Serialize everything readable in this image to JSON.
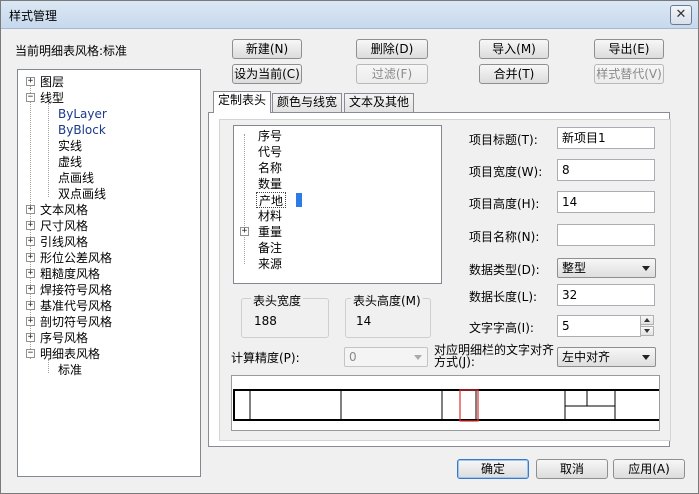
{
  "window": {
    "title": "样式管理",
    "close_glyph": "✕"
  },
  "current_style_label": "当前明细表风格:标准",
  "actions": {
    "new": "新建(N)",
    "delete": "删除(D)",
    "import": "导入(M)",
    "export": "导出(E)",
    "set_current": "设为当前(C)",
    "filter": "过滤(F)",
    "merge": "合并(T)",
    "replace_style": "样式替代(V)"
  },
  "tree": {
    "items": [
      {
        "label": "图层",
        "expander": "+"
      },
      {
        "label": "线型",
        "expander": "−"
      },
      {
        "label": "ByLayer"
      },
      {
        "label": "ByBlock"
      },
      {
        "label": "实线"
      },
      {
        "label": "虚线"
      },
      {
        "label": "点画线"
      },
      {
        "label": "双点画线"
      },
      {
        "label": "文本风格",
        "expander": "+"
      },
      {
        "label": "尺寸风格",
        "expander": "+"
      },
      {
        "label": "引线风格",
        "expander": "+"
      },
      {
        "label": "形位公差风格",
        "expander": "+"
      },
      {
        "label": "粗糙度风格",
        "expander": "+"
      },
      {
        "label": "焊接符号风格",
        "expander": "+"
      },
      {
        "label": "基准代号风格",
        "expander": "+"
      },
      {
        "label": "剖切符号风格",
        "expander": "+"
      },
      {
        "label": "序号风格",
        "expander": "+"
      },
      {
        "label": "明细表风格",
        "expander": "−"
      },
      {
        "label": "标准"
      }
    ]
  },
  "tabs": [
    {
      "label": "定制表头",
      "active": true
    },
    {
      "label": "颜色与线宽",
      "active": false
    },
    {
      "label": "文本及其他",
      "active": false
    }
  ],
  "header_fields": [
    {
      "label": "序号"
    },
    {
      "label": "代号"
    },
    {
      "label": "名称"
    },
    {
      "label": "数量"
    },
    {
      "label": "产地",
      "selected": true
    },
    {
      "label": "材料"
    },
    {
      "label": "重量",
      "expander": "+"
    },
    {
      "label": "备注"
    },
    {
      "label": "来源"
    }
  ],
  "header_size": {
    "width_label": "表头宽度",
    "width_value": "188",
    "height_label": "表头高度(M)",
    "height_value": "14"
  },
  "precision": {
    "label": "计算精度(P):",
    "value": "0"
  },
  "alignment": {
    "label_line1": "对应明细栏的文字对齐",
    "label_line2": "方式(J):",
    "value": "左中对齐"
  },
  "properties": {
    "title_label": "项目标题(T):",
    "title_value": "新项目1",
    "width_label": "项目宽度(W):",
    "width_value": "8",
    "height_label": "项目高度(H):",
    "height_value": "14",
    "name_label": "项目名称(N):",
    "name_value": "",
    "datatype_label": "数据类型(D):",
    "datatype_value": "整型",
    "datalength_label": "数据长度(L):",
    "datalength_value": "32",
    "textheight_label": "文字字高(I):",
    "textheight_value": "5"
  },
  "footer": {
    "ok": "确定",
    "cancel": "取消",
    "apply": "应用(A)"
  },
  "colors": {
    "selection_marker": "#2d7be5",
    "preview_highlight": "#e03030"
  }
}
